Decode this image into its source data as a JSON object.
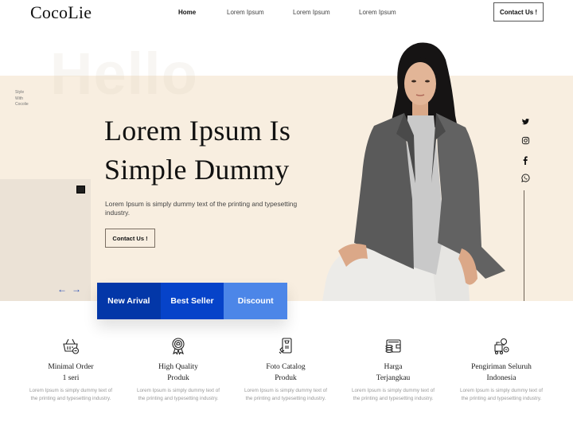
{
  "header": {
    "logo": "CocoLie",
    "nav": [
      {
        "label": "Home",
        "active": true
      },
      {
        "label": "Lorem Ipsum",
        "active": false
      },
      {
        "label": "Lorem Ipsum",
        "active": false
      },
      {
        "label": "Lorem Ipsum",
        "active": false
      }
    ],
    "contact_label": "Contact Us !"
  },
  "hero": {
    "background_word": "Hello",
    "side_tag": [
      "Style",
      "With",
      "Cocolie"
    ],
    "title_line1": "Lorem Ipsum Is",
    "title_line2": "Simple Dummy",
    "description": "Lorem Ipsum is simply dummy text of the printing and typesetting industry.",
    "contact_label": "Contact Us !",
    "prev_arrow": "←",
    "next_arrow": "→"
  },
  "tabs": [
    {
      "label": "New Arival",
      "color": "#0337a8"
    },
    {
      "label": "Best Seller",
      "color": "#0643c9"
    },
    {
      "label": "Discount",
      "color": "#4c86e8"
    }
  ],
  "social": [
    {
      "name": "twitter-icon"
    },
    {
      "name": "instagram-icon"
    },
    {
      "name": "facebook-icon"
    },
    {
      "name": "whatsapp-icon"
    }
  ],
  "features": [
    {
      "icon": "shopping-basket-icon",
      "title_line1": "Minimal Order",
      "title_line2": "1 seri",
      "description": "Lorem Ipsum is simply dummy text of the printing and typesetting industry."
    },
    {
      "icon": "quality-badge-icon",
      "title_line1": "High Quality",
      "title_line2": "Produk",
      "description": "Lorem Ipsum is simply dummy text of the printing and typesetting industry."
    },
    {
      "icon": "phone-photo-catalog-icon",
      "title_line1": "Foto Catalog",
      "title_line2": "Produk",
      "description": "Lorem Ipsum is simply dummy text of the printing and typesetting industry."
    },
    {
      "icon": "wallet-coins-icon",
      "title_line1": "Harga",
      "title_line2": "Terjangkau",
      "description": "Lorem Ipsum is simply dummy text of the printing and typesetting industry."
    },
    {
      "icon": "delivery-location-icon",
      "title_line1": "Pengiriman Seluruh",
      "title_line2": "Indonesia",
      "description": "Lorem Ipsum is simply dummy text of the printing and typesetting industry."
    }
  ],
  "colors": {
    "hero_bg": "#f8eee0",
    "hero_block": "#ebe2d6",
    "accent_dark": "#0337a8",
    "accent_mid": "#0643c9",
    "accent_light": "#4c86e8"
  }
}
